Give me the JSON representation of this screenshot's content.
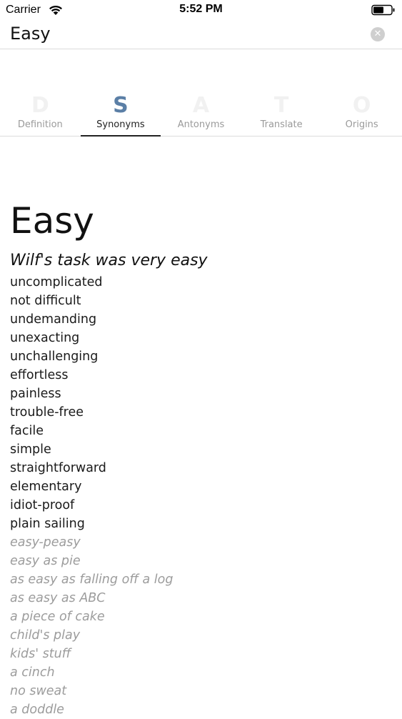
{
  "status_bar": {
    "carrier": "Carrier",
    "time": "5:52 PM"
  },
  "search": {
    "value": "Easy",
    "clear_icon": "clear-icon"
  },
  "tabs": [
    {
      "letter": "D",
      "label": "Definition",
      "active": false
    },
    {
      "letter": "S",
      "label": "Synonyms",
      "active": true
    },
    {
      "letter": "A",
      "label": "Antonyms",
      "active": false
    },
    {
      "letter": "T",
      "label": "Translate",
      "active": false
    },
    {
      "letter": "O",
      "label": "Origins",
      "active": false
    }
  ],
  "colors": {
    "active_tab_letter": "#5b7fa6",
    "informal_text": "#9c9c9c"
  },
  "entry": {
    "headword": "Easy",
    "example": "Wilf's task was very easy",
    "synonyms": [
      "uncomplicated",
      "not difficult",
      "undemanding",
      "unexacting",
      "unchallenging",
      "effortless",
      "painless",
      "trouble-free",
      "facile",
      "simple",
      "straightforward",
      "elementary",
      "idiot-proof",
      "plain sailing"
    ],
    "informal_synonyms": [
      "easy-peasy",
      "easy as pie",
      "as easy as falling off a log",
      "as easy as ABC",
      "a piece of cake",
      "child's play",
      "kids' stuff",
      "a cinch",
      "no sweat",
      "a doddle"
    ]
  }
}
